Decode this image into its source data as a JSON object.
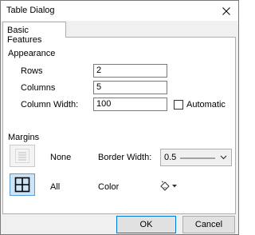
{
  "window": {
    "title": "Table Dialog"
  },
  "tabs": [
    {
      "label": "Basic Features"
    }
  ],
  "appearance": {
    "heading": "Appearance",
    "rows": {
      "label": "Rows",
      "value": "2"
    },
    "columns": {
      "label": "Columns",
      "value": "5"
    },
    "column_width": {
      "label": "Column Width:",
      "value": "100"
    },
    "automatic": {
      "label": "Automatic",
      "checked": false
    }
  },
  "margins": {
    "heading": "Margins",
    "none_label": "None",
    "all_label": "All",
    "selected": "All",
    "border_width": {
      "label": "Border Width:",
      "value": "0.5"
    },
    "color": {
      "label": "Color",
      "icon": "paint-bucket-icon"
    }
  },
  "buttons": {
    "ok": "OK",
    "cancel": "Cancel"
  },
  "colors": {
    "accent": "#0078d7",
    "selected_fill": "#cce4f7"
  }
}
